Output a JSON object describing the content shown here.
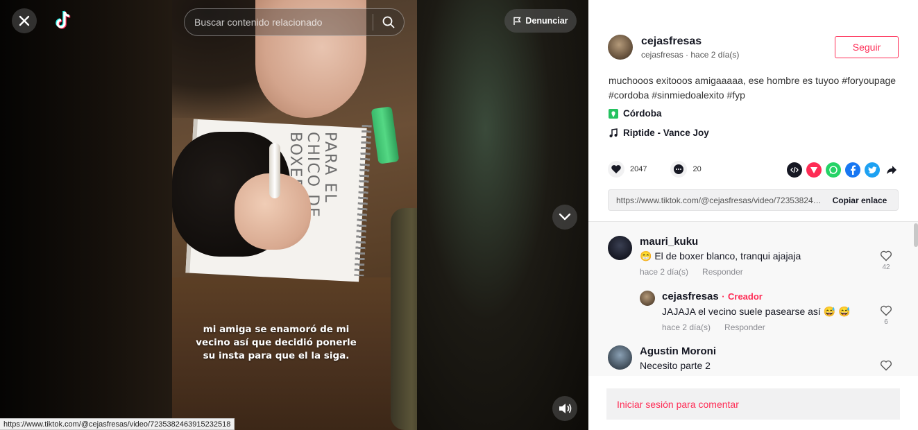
{
  "player": {
    "search_placeholder": "Buscar contenido relacionado",
    "report_label": "Denunciar",
    "caption": "mi amiga se enamoró de mi vecino así que decidió ponerle su insta para que el la siga.",
    "notebook_text": "PARA EL CHICO DE BOXER",
    "status_url": "https://www.tiktok.com/@cejasfresas/video/7235382463915232518"
  },
  "author": {
    "username": "cejasfresas",
    "subline": "cejasfresas · hace 2 día(s)",
    "follow_label": "Seguir"
  },
  "post": {
    "description": "muchooos exitooos amigaaaaa, ese hombre es tuyoo #foryoupage #cordoba #sinmiedoalexito #fyp",
    "location": "Córdoba",
    "music": "Riptide - Vance Joy",
    "likes": "2047",
    "comments": "20",
    "link": "https://www.tiktok.com/@cejasfresas/video/7235382463915232518",
    "copy_label": "Copiar enlace"
  },
  "comments": [
    {
      "user": "mauri_kuku",
      "emoji": "😁",
      "text": "El de boxer blanco, tranqui ajajaja",
      "time": "hace 2 día(s)",
      "reply": "Responder",
      "likes": "42"
    },
    {
      "user": "cejasfresas",
      "badge": "Creador",
      "text": "JAJAJA el vecino suele pasearse así 😅 😅",
      "time": "hace 2 día(s)",
      "reply": "Responder",
      "likes": "6"
    },
    {
      "user": "Agustin Moroni",
      "text": "Necesito parte 2"
    }
  ],
  "login_prompt": "Iniciar sesión para comentar",
  "colors": {
    "brand": "#fe2c55",
    "location_pin": "#25c260"
  }
}
